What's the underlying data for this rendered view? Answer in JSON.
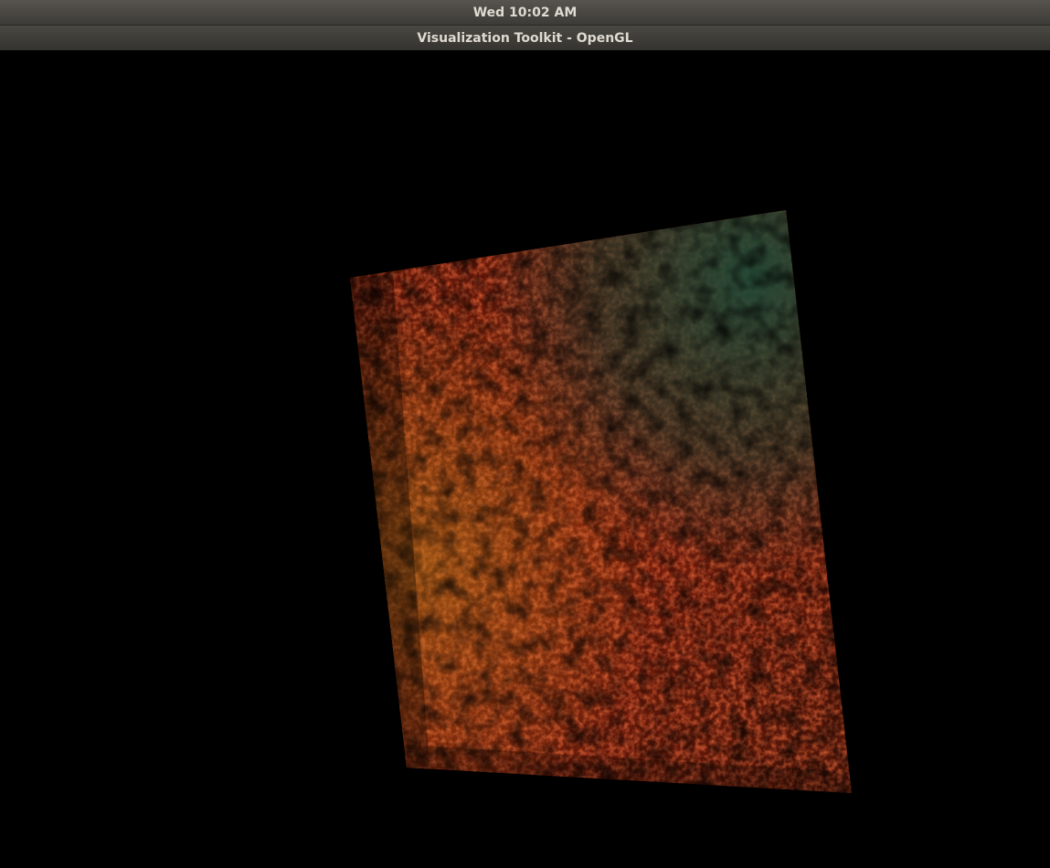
{
  "top_panel": {
    "clock": "Wed 10:02 AM"
  },
  "window": {
    "title": "Visualization Toolkit - OpenGL"
  },
  "render": {
    "background_color": "#000000",
    "image_colors": {
      "dominant": "#8a1a0c",
      "dark": "#3a0e06",
      "accent_yellow": "#c9a020",
      "accent_teal": "#1e4a38"
    }
  }
}
